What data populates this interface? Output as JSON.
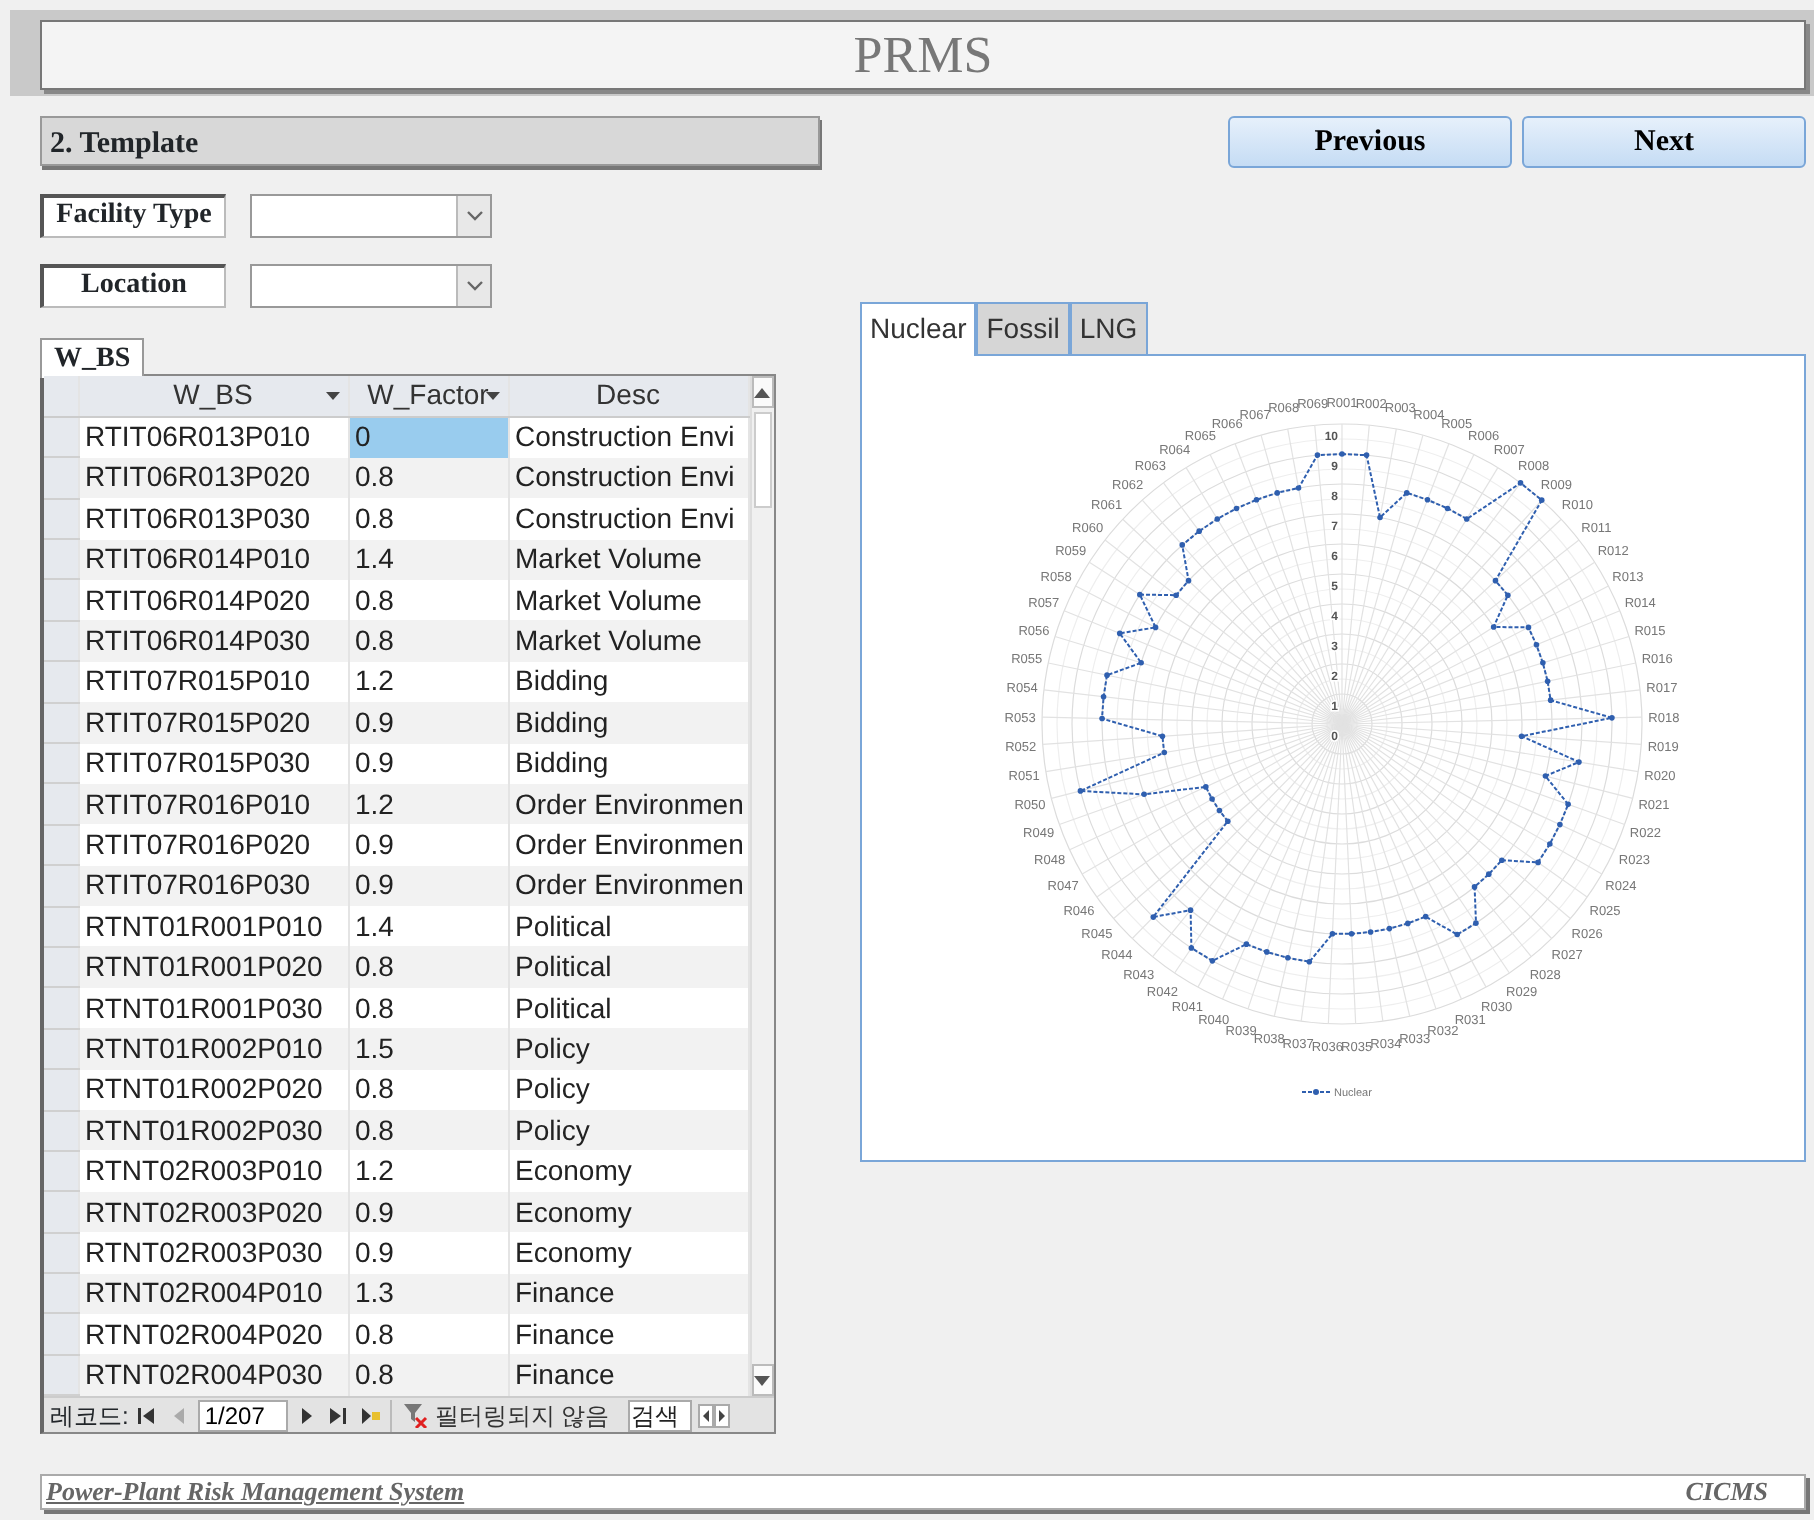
{
  "header": {
    "title": "PRMS"
  },
  "section": {
    "title": "2. Template"
  },
  "buttons": [
    {
      "label": "Previous"
    },
    {
      "label": "Next"
    }
  ],
  "filters": [
    {
      "label": "Facility Type"
    },
    {
      "label": "Location"
    }
  ],
  "datasheet": {
    "tab": "W_BS",
    "columns": [
      {
        "label": "W_BS",
        "filter": true,
        "selected": false
      },
      {
        "label": "W_Factor",
        "filter": true,
        "selected": true
      },
      {
        "label": "Desc",
        "filter": false,
        "selected": false
      }
    ],
    "rows": [
      {
        "cells": [
          "RTIT06R013P010",
          "0",
          "Construction Envi"
        ],
        "selected": true
      },
      {
        "cells": [
          "RTIT06R013P020",
          "0.8",
          "Construction Envi"
        ],
        "selected": false
      },
      {
        "cells": [
          "RTIT06R013P030",
          "0.8",
          "Construction Envi"
        ],
        "selected": false
      },
      {
        "cells": [
          "RTIT06R014P010",
          "1.4",
          "Market Volume"
        ],
        "selected": false
      },
      {
        "cells": [
          "RTIT06R014P020",
          "0.8",
          "Market Volume"
        ],
        "selected": false
      },
      {
        "cells": [
          "RTIT06R014P030",
          "0.8",
          "Market Volume"
        ],
        "selected": false
      },
      {
        "cells": [
          "RTIT07R015P010",
          "1.2",
          "Bidding"
        ],
        "selected": false
      },
      {
        "cells": [
          "RTIT07R015P020",
          "0.9",
          "Bidding"
        ],
        "selected": false
      },
      {
        "cells": [
          "RTIT07R015P030",
          "0.9",
          "Bidding"
        ],
        "selected": false
      },
      {
        "cells": [
          "RTIT07R016P010",
          "1.2",
          "Order Environmen"
        ],
        "selected": false
      },
      {
        "cells": [
          "RTIT07R016P020",
          "0.9",
          "Order Environmen"
        ],
        "selected": false
      },
      {
        "cells": [
          "RTIT07R016P030",
          "0.9",
          "Order Environmen"
        ],
        "selected": false
      },
      {
        "cells": [
          "RTNT01R001P010",
          "1.4",
          "Political"
        ],
        "selected": false
      },
      {
        "cells": [
          "RTNT01R001P020",
          "0.8",
          "Political"
        ],
        "selected": false
      },
      {
        "cells": [
          "RTNT01R001P030",
          "0.8",
          "Political"
        ],
        "selected": false
      },
      {
        "cells": [
          "RTNT01R002P010",
          "1.5",
          "Policy"
        ],
        "selected": false
      },
      {
        "cells": [
          "RTNT01R002P020",
          "0.8",
          "Policy"
        ],
        "selected": false
      },
      {
        "cells": [
          "RTNT01R002P030",
          "0.8",
          "Policy"
        ],
        "selected": false
      },
      {
        "cells": [
          "RTNT02R003P010",
          "1.2",
          "Economy"
        ],
        "selected": false
      },
      {
        "cells": [
          "RTNT02R003P020",
          "0.9",
          "Economy"
        ],
        "selected": false
      },
      {
        "cells": [
          "RTNT02R003P030",
          "0.9",
          "Economy"
        ],
        "selected": false
      },
      {
        "cells": [
          "RTNT02R004P010",
          "1.3",
          "Finance"
        ],
        "selected": false
      },
      {
        "cells": [
          "RTNT02R004P020",
          "0.8",
          "Finance"
        ],
        "selected": false
      },
      {
        "cells": [
          "RTNT02R004P030",
          "0.8",
          "Finance"
        ],
        "selected": false
      }
    ],
    "navigator": {
      "label": "레코드:",
      "position": "1/207",
      "filter_status": "필터링되지 않음",
      "search_placeholder": "검색"
    }
  },
  "chart_tabs": [
    {
      "label": "Nuclear",
      "selected": true
    },
    {
      "label": "Fossil",
      "selected": false
    },
    {
      "label": "LNG",
      "selected": false
    }
  ],
  "chart": {
    "chart_data": {
      "type": "radar",
      "categories": [
        "R001",
        "R002",
        "R003",
        "R004",
        "R005",
        "R006",
        "R007",
        "R008",
        "R009",
        "R010",
        "R011",
        "R012",
        "R013",
        "R014",
        "R015",
        "R016",
        "R017",
        "R018",
        "R019",
        "R020",
        "R021",
        "R022",
        "R023",
        "R024",
        "R025",
        "R026",
        "R027",
        "R028",
        "R029",
        "R030",
        "R031",
        "R032",
        "R033",
        "R034",
        "R035",
        "R036",
        "R037",
        "R038",
        "R039",
        "R040",
        "R041",
        "R042",
        "R043",
        "R044",
        "R045",
        "R046",
        "R047",
        "R048",
        "R049",
        "R050",
        "R051",
        "R052",
        "R053",
        "R054",
        "R055",
        "R056",
        "R057",
        "R058",
        "R059",
        "R060",
        "R061",
        "R062",
        "R063",
        "R064",
        "R065",
        "R066",
        "R067",
        "R068",
        "R069"
      ],
      "series": [
        {
          "name": "Nuclear",
          "color": "#2f5faf",
          "values": [
            9,
            9,
            7,
            8,
            8,
            8,
            8,
            10,
            10,
            7,
            7,
            6,
            7,
            7,
            7,
            7,
            7,
            9,
            6,
            8,
            7,
            8,
            8,
            8,
            8,
            7,
            7,
            7,
            8,
            8,
            7,
            7,
            7,
            7,
            7,
            7,
            8,
            8,
            8,
            8,
            9,
            9,
            8,
            9,
            5,
            5,
            5,
            5,
            7,
            9,
            6,
            6,
            8,
            8,
            8,
            7,
            8,
            7,
            8,
            7,
            7,
            8,
            8,
            8,
            8,
            8,
            8,
            8,
            9
          ]
        }
      ],
      "ylim": [
        0,
        10
      ],
      "yticks": [
        0,
        1,
        2,
        3,
        4,
        5,
        6,
        7,
        8,
        9,
        10
      ]
    }
  },
  "footer": {
    "left": "Power-Plant Risk Management System",
    "right": "CICMS"
  }
}
